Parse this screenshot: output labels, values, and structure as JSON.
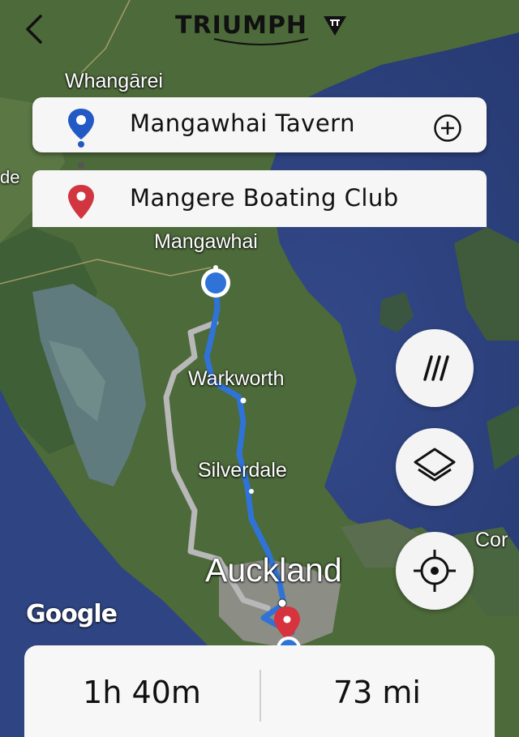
{
  "header": {
    "back_icon": "chevron-left-icon",
    "logo_text": "TRIUMPH"
  },
  "route": {
    "origin": "Mangawhai Tavern",
    "destination": "Mangere Boating Club",
    "add_icon": "plus-circle-icon"
  },
  "map": {
    "labels": {
      "whangarei": "Whangārei",
      "mangawhai": "Mangawhai",
      "warkworth": "Warkworth",
      "silverdale": "Silverdale",
      "auckland": "Auckland",
      "cor": "Cor",
      "de": "de"
    },
    "attribution": "Google",
    "route_color": "#2f73d8",
    "alt_route_color": "#b8b8b8"
  },
  "controls": {
    "style_icon": "slashes-icon",
    "layers_icon": "layers-icon",
    "locate_icon": "crosshair-icon"
  },
  "summary": {
    "duration": "1h 40m",
    "distance": "73 mi"
  }
}
